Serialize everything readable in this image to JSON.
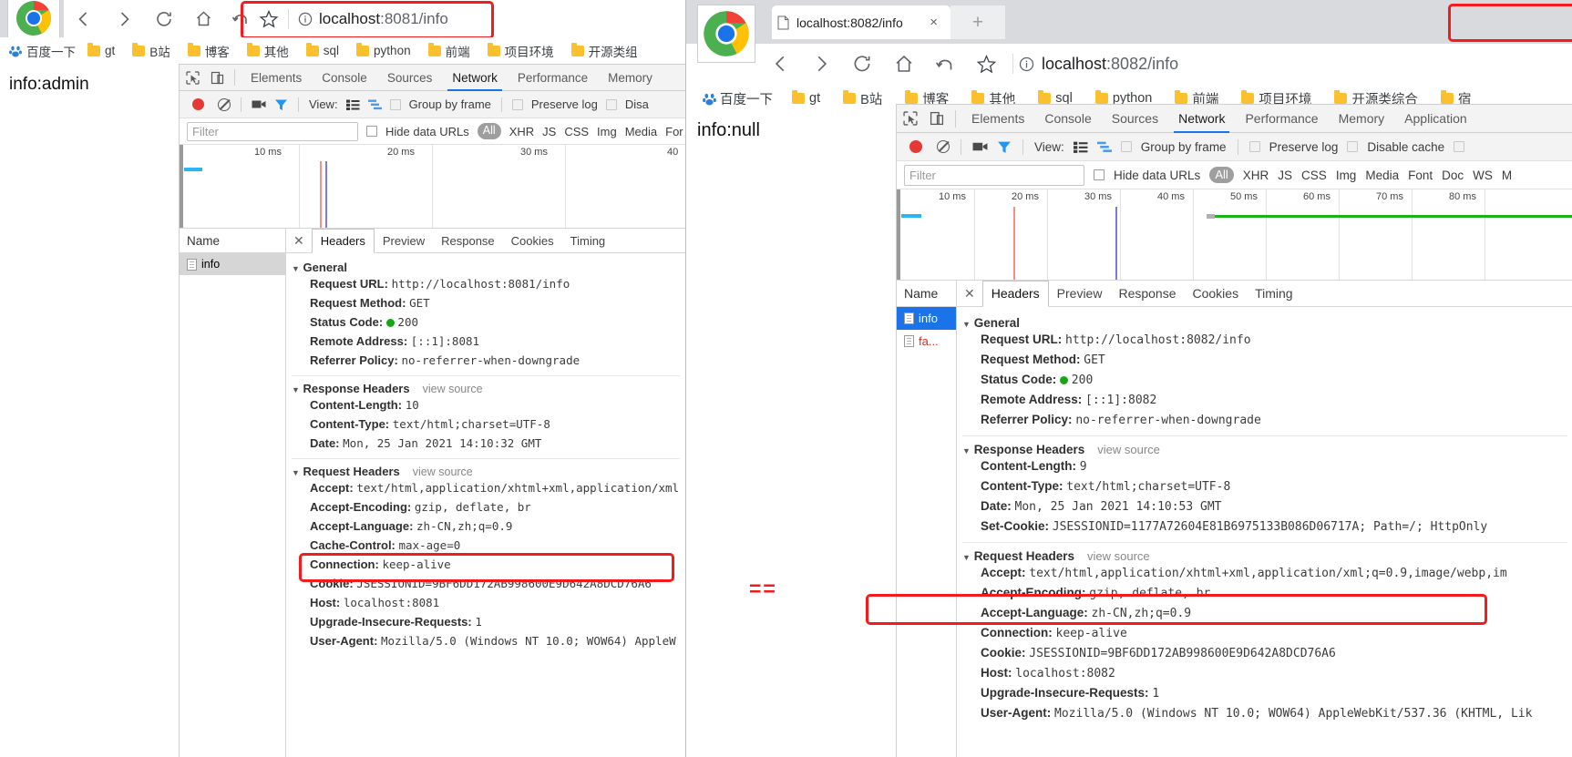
{
  "left_window": {
    "tab": {
      "title": "",
      "favicon": "star-icon"
    },
    "omnibox": {
      "icon": "info-circle-icon",
      "host": "localhost",
      "path": ":8081/info",
      "full": "localhost:8081/info"
    },
    "nav": {
      "back": "back-icon",
      "forward": "forward-icon",
      "reload": "reload-icon",
      "home": "home-icon",
      "history": "history-back-icon",
      "bookmark": "star-icon"
    },
    "bookmarks": [
      {
        "label": "百度一下",
        "icon": "baidu-icon"
      },
      {
        "label": "gt",
        "icon": "folder-icon"
      },
      {
        "label": "B站",
        "icon": "folder-icon"
      },
      {
        "label": "博客",
        "icon": "folder-icon"
      },
      {
        "label": "其他",
        "icon": "folder-icon"
      },
      {
        "label": "sql",
        "icon": "folder-icon"
      },
      {
        "label": "python",
        "icon": "folder-icon"
      },
      {
        "label": "前端",
        "icon": "folder-icon"
      },
      {
        "label": "项目环境",
        "icon": "folder-icon"
      },
      {
        "label": "开源类组",
        "icon": "folder-icon"
      }
    ],
    "page_text": "info:admin",
    "devtools": {
      "tabs": [
        "Elements",
        "Console",
        "Sources",
        "Network",
        "Performance",
        "Memory"
      ],
      "active_tab": "Network",
      "toolbar": {
        "view_label": "View:",
        "group_by_frame": "Group by frame",
        "preserve_log": "Preserve log",
        "disable_cache": "Disa"
      },
      "filter": {
        "placeholder": "Filter",
        "value": "",
        "hide_data_urls": "Hide data URLs",
        "all": "All",
        "types": [
          "XHR",
          "JS",
          "CSS",
          "Img",
          "Media",
          "For"
        ]
      },
      "timeline_ticks": [
        "10 ms",
        "20 ms",
        "30 ms",
        "40"
      ],
      "name_header": "Name",
      "requests": [
        {
          "name": "info",
          "selected": true
        }
      ],
      "detail_tabs": [
        "Headers",
        "Preview",
        "Response",
        "Cookies",
        "Timing"
      ],
      "detail_active": "Headers",
      "sections": [
        {
          "title": "General",
          "view_source": "",
          "rows": [
            {
              "key": "Request URL:",
              "value": "http://localhost:8081/info"
            },
            {
              "key": "Request Method:",
              "value": "GET"
            },
            {
              "key": "Status Code:",
              "value": "200",
              "status_dot": true
            },
            {
              "key": "Remote Address:",
              "value": "[::1]:8081"
            },
            {
              "key": "Referrer Policy:",
              "value": "no-referrer-when-downgrade"
            }
          ]
        },
        {
          "title": "Response Headers",
          "view_source": "view source",
          "rows": [
            {
              "key": "Content-Length:",
              "value": "10"
            },
            {
              "key": "Content-Type:",
              "value": "text/html;charset=UTF-8"
            },
            {
              "key": "Date:",
              "value": "Mon, 25 Jan 2021 14:10:32 GMT"
            }
          ]
        },
        {
          "title": "Request Headers",
          "view_source": "view source",
          "rows": [
            {
              "key": "Accept:",
              "value": "text/html,application/xhtml+xml,application/xml"
            },
            {
              "key": "Accept-Encoding:",
              "value": "gzip, deflate, br"
            },
            {
              "key": "Accept-Language:",
              "value": "zh-CN,zh;q=0.9"
            },
            {
              "key": "Cache-Control:",
              "value": "max-age=0"
            },
            {
              "key": "Connection:",
              "value": "keep-alive"
            },
            {
              "key": "Cookie:",
              "value": "JSESSIONID=9BF6DD172AB998600E9D642A8DCD76A6",
              "highlight": true
            },
            {
              "key": "Host:",
              "value": "localhost:8081"
            },
            {
              "key": "Upgrade-Insecure-Requests:",
              "value": "1"
            },
            {
              "key": "User-Agent:",
              "value": "Mozilla/5.0 (Windows NT 10.0; WOW64) AppleW"
            }
          ]
        }
      ]
    }
  },
  "right_window": {
    "tab": {
      "title": "localhost:8082/info",
      "close": "×",
      "newtab": "+",
      "favicon": "document-icon"
    },
    "omnibox": {
      "icon": "info-circle-icon",
      "host": "localhost",
      "path": ":8082/info",
      "full": "localhost:8082/info"
    },
    "bookmarks": [
      {
        "label": "百度一下",
        "icon": "baidu-icon"
      },
      {
        "label": "gt",
        "icon": "folder-icon"
      },
      {
        "label": "B站",
        "icon": "folder-icon"
      },
      {
        "label": "博客",
        "icon": "folder-icon"
      },
      {
        "label": "其他",
        "icon": "folder-icon"
      },
      {
        "label": "sql",
        "icon": "folder-icon"
      },
      {
        "label": "python",
        "icon": "folder-icon"
      },
      {
        "label": "前端",
        "icon": "folder-icon"
      },
      {
        "label": "项目环境",
        "icon": "folder-icon"
      },
      {
        "label": "开源类综合",
        "icon": "folder-icon"
      },
      {
        "label": "宿",
        "icon": "folder-icon"
      }
    ],
    "page_text": "info:null",
    "devtools": {
      "tabs": [
        "Elements",
        "Console",
        "Sources",
        "Network",
        "Performance",
        "Memory",
        "Application"
      ],
      "active_tab": "Network",
      "toolbar": {
        "view_label": "View:",
        "group_by_frame": "Group by frame",
        "preserve_log": "Preserve log",
        "disable_cache": "Disable cache"
      },
      "filter": {
        "placeholder": "Filter",
        "value": "",
        "hide_data_urls": "Hide data URLs",
        "all": "All",
        "types": [
          "XHR",
          "JS",
          "CSS",
          "Img",
          "Media",
          "Font",
          "Doc",
          "WS",
          "M"
        ]
      },
      "timeline_ticks": [
        "10 ms",
        "20 ms",
        "30 ms",
        "40 ms",
        "50 ms",
        "60 ms",
        "70 ms",
        "80 ms"
      ],
      "name_header": "Name",
      "requests": [
        {
          "name": "info",
          "selected": true
        },
        {
          "name": "fa...",
          "selected": false
        }
      ],
      "detail_tabs": [
        "Headers",
        "Preview",
        "Response",
        "Cookies",
        "Timing"
      ],
      "detail_active": "Headers",
      "sections": [
        {
          "title": "General",
          "view_source": "",
          "rows": [
            {
              "key": "Request URL:",
              "value": "http://localhost:8082/info"
            },
            {
              "key": "Request Method:",
              "value": "GET"
            },
            {
              "key": "Status Code:",
              "value": "200",
              "status_dot": true
            },
            {
              "key": "Remote Address:",
              "value": "[::1]:8082"
            },
            {
              "key": "Referrer Policy:",
              "value": "no-referrer-when-downgrade"
            }
          ]
        },
        {
          "title": "Response Headers",
          "view_source": "view source",
          "rows": [
            {
              "key": "Content-Length:",
              "value": "9"
            },
            {
              "key": "Content-Type:",
              "value": "text/html;charset=UTF-8"
            },
            {
              "key": "Date:",
              "value": "Mon, 25 Jan 2021 14:10:53 GMT"
            },
            {
              "key": "Set-Cookie:",
              "value": "JSESSIONID=1177A72604E81B6975133B086D06717A; Path=/; HttpOnly"
            }
          ]
        },
        {
          "title": "Request Headers",
          "view_source": "view source",
          "rows": [
            {
              "key": "Accept:",
              "value": "text/html,application/xhtml+xml,application/xml;q=0.9,image/webp,im"
            },
            {
              "key": "Accept-Encoding:",
              "value": "gzip, deflate, br"
            },
            {
              "key": "Accept-Language:",
              "value": "zh-CN,zh;q=0.9"
            },
            {
              "key": "Connection:",
              "value": "keep-alive"
            },
            {
              "key": "Cookie:",
              "value": "JSESSIONID=9BF6DD172AB998600E9D642A8DCD76A6",
              "highlight": true
            },
            {
              "key": "Host:",
              "value": "localhost:8082"
            },
            {
              "key": "Upgrade-Insecure-Requests:",
              "value": "1"
            },
            {
              "key": "User-Agent:",
              "value": "Mozilla/5.0 (Windows NT 10.0; WOW64) AppleWebKit/537.36 (KHTML, Lik"
            }
          ]
        }
      ]
    }
  },
  "annotation": {
    "equals_mark": "==",
    "highlight_color": "#f31b1b"
  }
}
